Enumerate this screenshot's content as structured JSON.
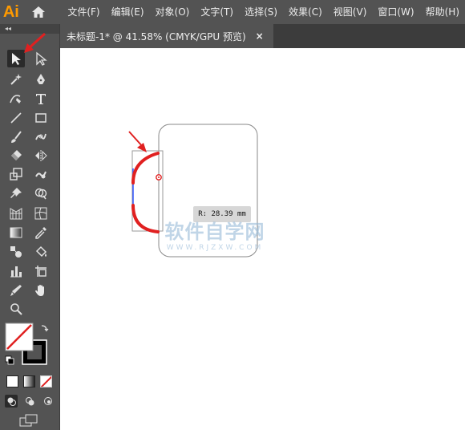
{
  "app": {
    "logo": "Ai"
  },
  "menubar": {
    "items": [
      {
        "label": "文件(F)"
      },
      {
        "label": "编辑(E)"
      },
      {
        "label": "对象(O)"
      },
      {
        "label": "文字(T)"
      },
      {
        "label": "选择(S)"
      },
      {
        "label": "效果(C)"
      },
      {
        "label": "视图(V)"
      },
      {
        "label": "窗口(W)"
      },
      {
        "label": "帮助(H)"
      }
    ]
  },
  "document_tab": {
    "title": "未标题-1* @ 41.58% (CMYK/GPU 预览)",
    "close_glyph": "×"
  },
  "toolbar": {
    "collapse_glyph": "◂◂"
  },
  "canvas": {
    "radius_readout": "R: 28.39 mm",
    "watermark_main": "软件自学网",
    "watermark_sub": "WWW.RJZXW.COM"
  },
  "colors": {
    "ui_dark": "#535353",
    "annotation_red": "#e02020",
    "path_blue": "#3355ff",
    "app_logo": "#ff9a00"
  }
}
